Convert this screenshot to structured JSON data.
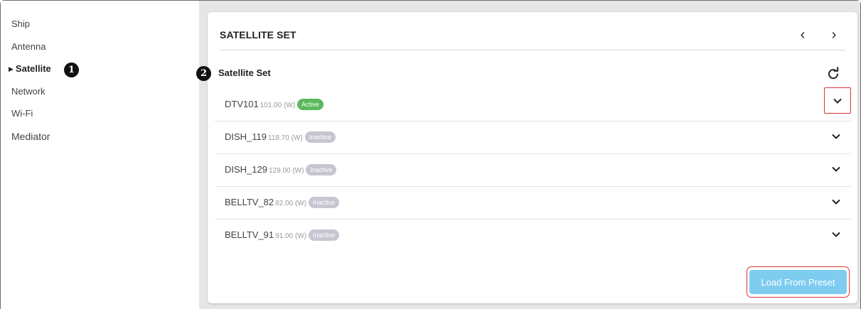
{
  "sidebar": {
    "items": [
      {
        "label": "Ship"
      },
      {
        "label": "Antenna"
      },
      {
        "label": "Satellite"
      },
      {
        "label": "Network"
      },
      {
        "label": "Wi-Fi"
      },
      {
        "label": "Mediator"
      }
    ],
    "active_marker": "▶",
    "callout_1": "1"
  },
  "card": {
    "title": "SATELLITE SET",
    "prev_label": "‹",
    "next_label": "›",
    "section_label": "Satellite Set",
    "callout_2": "2",
    "refresh_icon": "refresh-icon",
    "satellites": [
      {
        "name": "DTV101",
        "longitude": "101.00 (W)",
        "status": "Active"
      },
      {
        "name": "DISH_119",
        "longitude": "118.70 (W)",
        "status": "Inactive"
      },
      {
        "name": "DISH_129",
        "longitude": "129.00 (W)",
        "status": "Inactive"
      },
      {
        "name": "BELLTV_82",
        "longitude": "82.00 (W)",
        "status": "Inactive"
      },
      {
        "name": "BELLTV_91",
        "longitude": "91.00 (W)",
        "status": "Inactive"
      }
    ],
    "load_preset_label": "Load From Preset"
  },
  "colors": {
    "active_badge": "#5cb85c",
    "inactive_badge": "#c7c5d1",
    "preset_button": "#7ecdf1",
    "highlight_outline": "#d9343a"
  }
}
